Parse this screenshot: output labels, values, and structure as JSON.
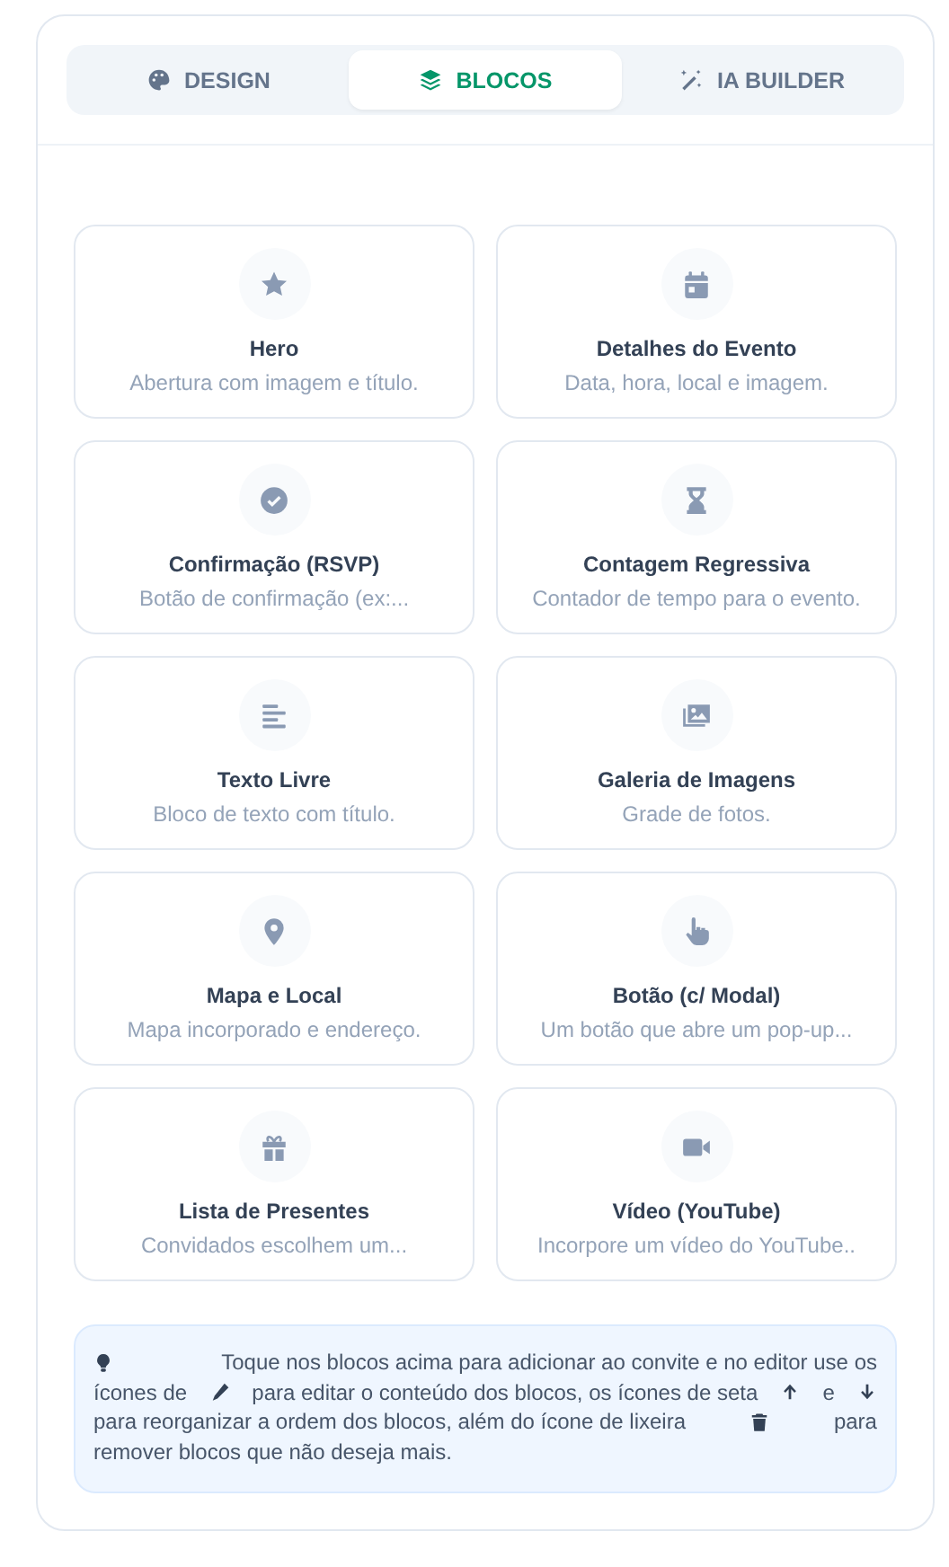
{
  "tabs": [
    {
      "label": "DESIGN",
      "selected": false
    },
    {
      "label": "BLOCOS",
      "selected": true
    },
    {
      "label": "IA BUILDER",
      "selected": false
    }
  ],
  "blocks": [
    {
      "title": "Hero",
      "description": "Abertura com imagem e título."
    },
    {
      "title": "Detalhes do Evento",
      "description": "Data, hora, local e imagem."
    },
    {
      "title": "Confirmação (RSVP)",
      "description": "Botão de confirmação (ex:..."
    },
    {
      "title": "Contagem Regressiva",
      "description": "Contador de tempo para o evento."
    },
    {
      "title": "Texto Livre",
      "description": "Bloco de texto com título."
    },
    {
      "title": "Galeria de Imagens",
      "description": "Grade de fotos."
    },
    {
      "title": "Mapa e Local",
      "description": "Mapa incorporado e endereço."
    },
    {
      "title": "Botão (c/ Modal)",
      "description": "Um botão que abre um pop-up..."
    },
    {
      "title": "Lista de Presentes",
      "description": "Convidados escolhem um..."
    },
    {
      "title": "Vídeo (YouTube)",
      "description": "Incorpore um vídeo do YouTube.."
    }
  ],
  "tip": [
    [
      {
        "kind": "icon"
      },
      {
        "kind": "text",
        "text": "Toque nos blocos acima para adicionar ao convite e no editor use os"
      }
    ],
    [
      {
        "kind": "text",
        "text": "ícones de"
      },
      {
        "kind": "icon"
      },
      {
        "kind": "text",
        "text": "para editar o conteúdo dos blocos, os ícones de seta"
      },
      {
        "kind": "icon"
      },
      {
        "kind": "text",
        "text": "e"
      },
      {
        "kind": "icon"
      }
    ],
    [
      {
        "kind": "text",
        "text": "para reorganizar a ordem dos blocos, além do ícone de lixeira"
      },
      {
        "kind": "icon"
      },
      {
        "kind": "text",
        "text": "para"
      }
    ],
    [
      {
        "kind": "text",
        "text": "remover blocos que não deseja mais."
      }
    ]
  ]
}
